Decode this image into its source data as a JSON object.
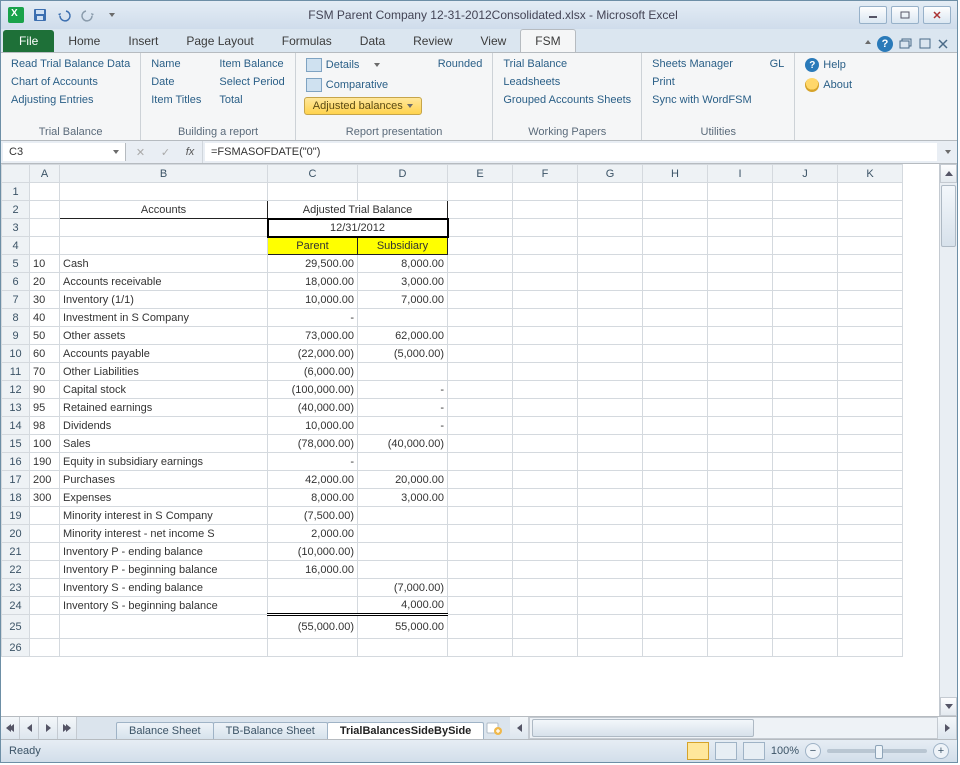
{
  "title": "FSM Parent Company 12-31-2012Consolidated.xlsx  -  Microsoft Excel",
  "tabs": [
    "Home",
    "Insert",
    "Page Layout",
    "Formulas",
    "Data",
    "Review",
    "View",
    "FSM"
  ],
  "activeTab": "FSM",
  "ribbon": {
    "g1": {
      "items": [
        "Read Trial Balance Data",
        "Chart of Accounts",
        "Adjusting Entries"
      ],
      "label": "Trial Balance"
    },
    "g2": {
      "colA": [
        "Name",
        "Date",
        "Item Titles"
      ],
      "colB": [
        "Item Balance",
        "Select Period",
        "Total"
      ],
      "label": "Building a report"
    },
    "g3": {
      "details": "Details",
      "rounded": "Rounded",
      "comparative": "Comparative",
      "adjusted": "Adjusted balances",
      "label": "Report presentation"
    },
    "g4": {
      "items": [
        "Trial Balance",
        "Leadsheets",
        "Grouped Accounts Sheets"
      ],
      "label": "Working Papers"
    },
    "g5": {
      "colA": [
        "Sheets Manager",
        "Print",
        "Sync with WordFSM"
      ],
      "gl": "GL",
      "label": "Utilities"
    },
    "g6": {
      "help": "Help",
      "about": "About"
    }
  },
  "namebox": "C3",
  "formula": "=FSMASOFDATE(\"0\")",
  "columns": [
    "A",
    "B",
    "C",
    "D",
    "E",
    "F",
    "G",
    "H",
    "I",
    "J",
    "K"
  ],
  "hdrAccounts": "Accounts",
  "hdrATB": "Adjusted Trial Balance",
  "hdrDate": "12/31/2012",
  "hdrParent": "Parent",
  "hdrSub": "Subsidiary",
  "rows": [
    {
      "n": 5,
      "a": "10",
      "b": "Cash",
      "c": "29,500.00",
      "d": "8,000.00"
    },
    {
      "n": 6,
      "a": "20",
      "b": "Accounts receivable",
      "c": "18,000.00",
      "d": "3,000.00"
    },
    {
      "n": 7,
      "a": "30",
      "b": "Inventory (1/1)",
      "c": "10,000.00",
      "d": "7,000.00"
    },
    {
      "n": 8,
      "a": "40",
      "b": "Investment in S Company",
      "c": "-",
      "d": ""
    },
    {
      "n": 9,
      "a": "50",
      "b": "Other assets",
      "c": "73,000.00",
      "d": "62,000.00"
    },
    {
      "n": 10,
      "a": "60",
      "b": "Accounts payable",
      "c": "(22,000.00)",
      "d": "(5,000.00)"
    },
    {
      "n": 11,
      "a": "70",
      "b": "Other Liabilities",
      "c": "(6,000.00)",
      "d": ""
    },
    {
      "n": 12,
      "a": "90",
      "b": "Capital stock",
      "c": "(100,000.00)",
      "d": "-"
    },
    {
      "n": 13,
      "a": "95",
      "b": "Retained earnings",
      "c": "(40,000.00)",
      "d": "-"
    },
    {
      "n": 14,
      "a": "98",
      "b": "Dividends",
      "c": "10,000.00",
      "d": "-"
    },
    {
      "n": 15,
      "a": "100",
      "b": "Sales",
      "c": "(78,000.00)",
      "d": "(40,000.00)"
    },
    {
      "n": 16,
      "a": "190",
      "b": "Equity in subsidiary earnings",
      "c": "-",
      "d": ""
    },
    {
      "n": 17,
      "a": "200",
      "b": "Purchases",
      "c": "42,000.00",
      "d": "20,000.00"
    },
    {
      "n": 18,
      "a": "300",
      "b": "Expenses",
      "c": "8,000.00",
      "d": "3,000.00"
    },
    {
      "n": 19,
      "a": "",
      "b": "Minority interest in S Company",
      "c": "(7,500.00)",
      "d": ""
    },
    {
      "n": 20,
      "a": "",
      "b": "Minority interest - net income S",
      "c": "2,000.00",
      "d": ""
    },
    {
      "n": 21,
      "a": "",
      "b": "Inventory P - ending balance",
      "c": "(10,000.00)",
      "d": ""
    },
    {
      "n": 22,
      "a": "",
      "b": "Inventory P - beginning balance",
      "c": "16,000.00",
      "d": ""
    },
    {
      "n": 23,
      "a": "",
      "b": "Inventory S - ending balance",
      "c": "",
      "d": "(7,000.00)"
    },
    {
      "n": 24,
      "a": "",
      "b": "Inventory S - beginning balance",
      "c": "",
      "d": "4,000.00"
    }
  ],
  "totalRow": {
    "n": 25,
    "c": "(55,000.00)",
    "d": "55,000.00"
  },
  "lastRow": 26,
  "sheetTabs": [
    "Balance Sheet",
    "TB-Balance Sheet",
    "TrialBalancesSideBySide"
  ],
  "activeSheet": "TrialBalancesSideBySide",
  "status": "Ready",
  "zoom": "100%"
}
